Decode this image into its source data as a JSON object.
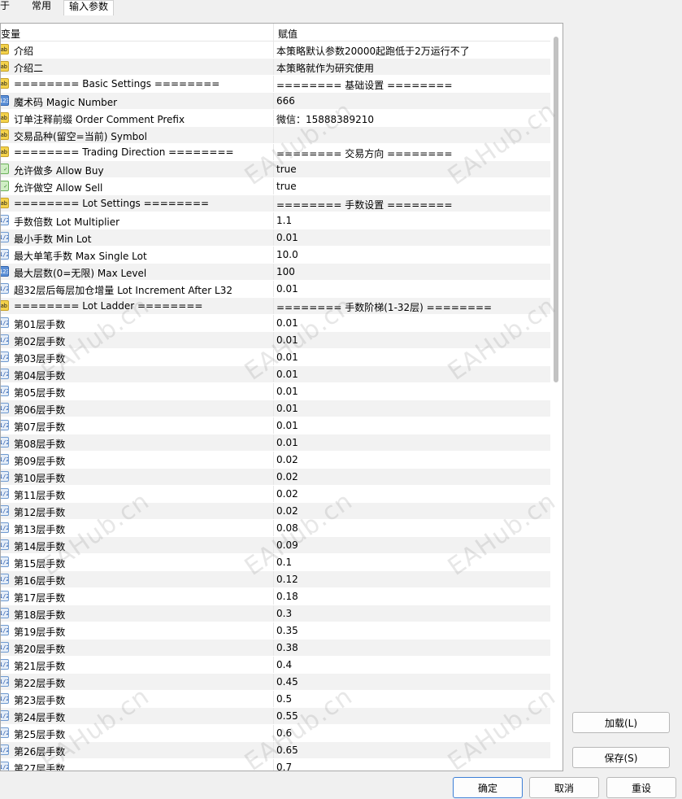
{
  "tabs": [
    "于",
    "常用",
    "输入参数"
  ],
  "columns": {
    "variable": "变量",
    "value": "赋值"
  },
  "rows": [
    {
      "icon": "ab",
      "name": "介绍",
      "value": "本策略默认参数20000起跑低于2万运行不了"
    },
    {
      "icon": "ab",
      "name": "介绍二",
      "value": "本策略就作为研究使用"
    },
    {
      "icon": "ab",
      "name": "======== Basic Settings ========",
      "value": "======== 基础设置 ========"
    },
    {
      "icon": "123",
      "name": "魔术码 Magic Number",
      "value": "666"
    },
    {
      "icon": "ab",
      "name": "订单注释前缀 Order Comment Prefix",
      "value": "微信：15888389210"
    },
    {
      "icon": "ab",
      "name": "交易品种(留空=当前) Symbol",
      "value": ""
    },
    {
      "icon": "ab",
      "name": "======== Trading Direction ========",
      "value": "======== 交易方向 ========"
    },
    {
      "icon": "bool",
      "name": "允许做多 Allow Buy",
      "value": "true"
    },
    {
      "icon": "bool",
      "name": "允许做空 Allow Sell",
      "value": "true"
    },
    {
      "icon": "ab",
      "name": "======== Lot Settings ========",
      "value": "======== 手数设置 ========"
    },
    {
      "icon": "dbl",
      "name": "手数倍数 Lot Multiplier",
      "value": "1.1"
    },
    {
      "icon": "dbl",
      "name": "最小手数 Min Lot",
      "value": "0.01"
    },
    {
      "icon": "dbl",
      "name": "最大单笔手数 Max Single Lot",
      "value": "10.0"
    },
    {
      "icon": "123",
      "name": "最大层数(0=无限) Max Level",
      "value": "100"
    },
    {
      "icon": "dbl",
      "name": "超32层后每层加仓增量 Lot Increment After L32",
      "value": "0.01"
    },
    {
      "icon": "ab",
      "name": "======== Lot Ladder ========",
      "value": "======== 手数阶梯(1-32层) ========"
    },
    {
      "icon": "dbl",
      "name": "第01层手数",
      "value": "0.01"
    },
    {
      "icon": "dbl",
      "name": "第02层手数",
      "value": "0.01"
    },
    {
      "icon": "dbl",
      "name": "第03层手数",
      "value": "0.01"
    },
    {
      "icon": "dbl",
      "name": "第04层手数",
      "value": "0.01"
    },
    {
      "icon": "dbl",
      "name": "第05层手数",
      "value": "0.01"
    },
    {
      "icon": "dbl",
      "name": "第06层手数",
      "value": "0.01"
    },
    {
      "icon": "dbl",
      "name": "第07层手数",
      "value": "0.01"
    },
    {
      "icon": "dbl",
      "name": "第08层手数",
      "value": "0.01"
    },
    {
      "icon": "dbl",
      "name": "第09层手数",
      "value": "0.02"
    },
    {
      "icon": "dbl",
      "name": "第10层手数",
      "value": "0.02"
    },
    {
      "icon": "dbl",
      "name": "第11层手数",
      "value": "0.02"
    },
    {
      "icon": "dbl",
      "name": "第12层手数",
      "value": "0.02"
    },
    {
      "icon": "dbl",
      "name": "第13层手数",
      "value": "0.08"
    },
    {
      "icon": "dbl",
      "name": "第14层手数",
      "value": "0.09"
    },
    {
      "icon": "dbl",
      "name": "第15层手数",
      "value": "0.1"
    },
    {
      "icon": "dbl",
      "name": "第16层手数",
      "value": "0.12"
    },
    {
      "icon": "dbl",
      "name": "第17层手数",
      "value": "0.18"
    },
    {
      "icon": "dbl",
      "name": "第18层手数",
      "value": "0.3"
    },
    {
      "icon": "dbl",
      "name": "第19层手数",
      "value": "0.35"
    },
    {
      "icon": "dbl",
      "name": "第20层手数",
      "value": "0.38"
    },
    {
      "icon": "dbl",
      "name": "第21层手数",
      "value": "0.4"
    },
    {
      "icon": "dbl",
      "name": "第22层手数",
      "value": "0.45"
    },
    {
      "icon": "dbl",
      "name": "第23层手数",
      "value": "0.5"
    },
    {
      "icon": "dbl",
      "name": "第24层手数",
      "value": "0.55"
    },
    {
      "icon": "dbl",
      "name": "第25层手数",
      "value": "0.6"
    },
    {
      "icon": "dbl",
      "name": "第26层手数",
      "value": "0.65"
    },
    {
      "icon": "dbl",
      "name": "第27层手数",
      "value": "0.7"
    }
  ],
  "watermark": "EAHub.cn",
  "buttons": {
    "load": "加载(L)",
    "save": "保存(S)",
    "ok": "确定",
    "cancel": "取消",
    "reset": "重设"
  }
}
